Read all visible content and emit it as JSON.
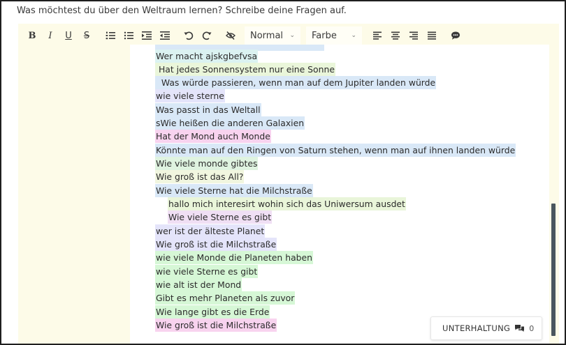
{
  "prompt": "Was möchtest du über den Weltraum lernen? Schreibe deine Fragen auf.",
  "toolbar": {
    "bold": "B",
    "italic": "I",
    "underline": "U",
    "strike": "S",
    "size_value": "Normal",
    "color_value": "Farbe"
  },
  "lines": [
    {
      "text": "",
      "bg": "#d9e8f7"
    },
    {
      "text": "Wer macht ajskgbefvsa",
      "bg": "#dbf2f1"
    },
    {
      "text": " Hat jedes Sonnensystem nur eine Sonne",
      "bg": "#eaf6da"
    },
    {
      "text": "  Was würde passieren, wenn man auf dem Jupiter landen würde",
      "bg": "#d9e8f7"
    },
    {
      "text": "wie viele sterne",
      "bg": "#e4e4fa"
    },
    {
      "text": "Was passt in das Weltall",
      "bg": "#d9e8f7"
    },
    {
      "text": "sWie heißen die anderen Galaxien",
      "bg": "#d9e8f7"
    },
    {
      "text": "Hat der Mond auch Monde",
      "bg": "#f8d3ef"
    },
    {
      "text": "Könnte man auf den Ringen von Saturn stehen, wenn man auf ihnen landen würde",
      "bg": "#d9e8f7"
    },
    {
      "text": "Wie viele monde gibtes",
      "bg": "#dff3e0"
    },
    {
      "text": "Wie groß ist das All?",
      "bg": "#f1f6df"
    },
    {
      "text": "Wie viele Sterne hat die Milchstraße",
      "bg": "#d9e8f7"
    },
    {
      "text": "hallo mich interesirt wohin sich das Uniwersum ausdet",
      "bg": "#e9f5d9"
    },
    {
      "text": "Wie viele Sterne es gibt",
      "bg": "#f0dff4"
    },
    {
      "text": "wer ist der älteste Planet",
      "bg": "#e4e4fa"
    },
    {
      "text": "Wie groß ist die Milchstraße",
      "bg": "#e4e4fa"
    },
    {
      "text": "wie viele Monde die Planeten haben",
      "bg": "#d6f7d6"
    },
    {
      "text": "wie viele Sterne es gibt",
      "bg": "#d6f7d6"
    },
    {
      "text": "wie alt ist der Mond",
      "bg": "#d6f7d6"
    },
    {
      "text": "Gibt es mehr Planeten als zuvor",
      "bg": "#d6f7d6"
    },
    {
      "text": "Wie lange gibt es die Erde",
      "bg": "#d6f7d6"
    },
    {
      "text": "Wie groß ist die Milchstraße",
      "bg": "#f8d3ef"
    }
  ],
  "chat": {
    "label": "UNTERHALTUNG",
    "count": "0"
  },
  "colors": {
    "editor_bg": "#fdfbe8",
    "scrollbar": "#4a565e"
  },
  "icons": [
    "ordered-list-icon",
    "bullet-list-icon",
    "indent-icon",
    "outdent-icon",
    "undo-icon",
    "redo-icon",
    "hide-icon",
    "align-left-icon",
    "align-center-icon",
    "align-right-icon",
    "align-justify-icon",
    "comment-icon",
    "chat-icon"
  ]
}
